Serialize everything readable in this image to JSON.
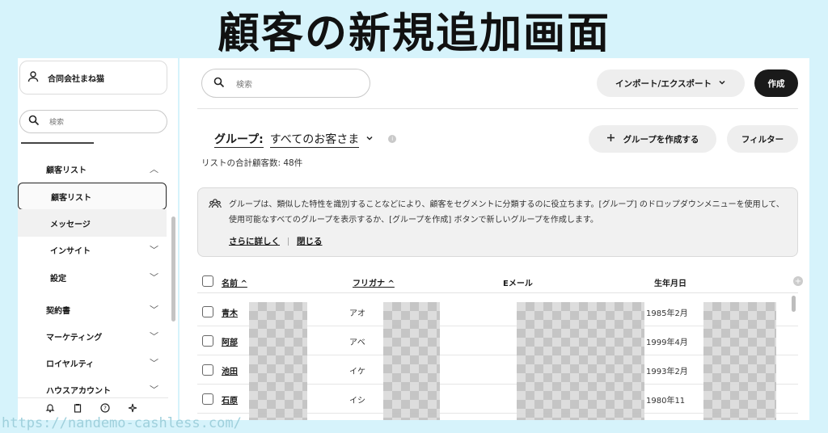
{
  "banner": {
    "title": "顧客の新規追加画面",
    "watermark": "https://nandemo-cashless.com/"
  },
  "sidebar": {
    "account_name": "合同会社まね猫",
    "search_placeholder": "検索",
    "items": [
      {
        "label": "顧客リスト",
        "chevron": "︿",
        "level": 1
      },
      {
        "label": "顧客リスト",
        "chevron": "",
        "level": 2,
        "active": true
      },
      {
        "label": "メッセージ",
        "chevron": "",
        "level": 2
      },
      {
        "label": "インサイト",
        "chevron": "﹀",
        "level": 2
      },
      {
        "label": "設定",
        "chevron": "﹀",
        "level": 2
      },
      {
        "label": "契約書",
        "chevron": "﹀",
        "level": 1
      },
      {
        "label": "マーケティング",
        "chevron": "﹀",
        "level": 1
      },
      {
        "label": "ロイヤルティ",
        "chevron": "﹀",
        "level": 1
      },
      {
        "label": "ハウスアカウント",
        "chevron": "﹀",
        "level": 1
      }
    ],
    "footer_icons": [
      "bell-icon",
      "clipboard-icon",
      "help-icon",
      "sparkle-icon"
    ]
  },
  "main": {
    "search_placeholder": "検索",
    "import_export_label": "インポート/エクスポート",
    "create_label": "作成",
    "group_label": "グループ:",
    "group_value": "すべてのお客さま",
    "create_group_label": "グループを作成する",
    "filter_label": "フィルター",
    "total_count": "リストの合計顧客数: 48件",
    "info": {
      "text": "グループは、類似した特性を識別することなどにより、顧客をセグメントに分類するのに役立ちます。[グループ] のドロップダウンメニューを使用して、使用可能なすべてのグループを表示するか、[グループを作成] ボタンで新しいグループを作成します。",
      "learn_more": "さらに詳しく",
      "close": "閉じる"
    },
    "table": {
      "columns": [
        "名前 ^",
        "フリガナ ^",
        "Eメール",
        "生年月日"
      ],
      "rows": [
        {
          "name": "青木",
          "kana": "アオ",
          "email": "",
          "birthday": "1985年2月"
        },
        {
          "name": "阿部",
          "kana": "アベ",
          "email": "",
          "birthday": "1999年4月"
        },
        {
          "name": "池田",
          "kana": "イケ",
          "email": "",
          "birthday": "1993年2月"
        },
        {
          "name": "石原",
          "kana": "イシ",
          "email": "",
          "birthday": "1980年11"
        }
      ]
    }
  }
}
